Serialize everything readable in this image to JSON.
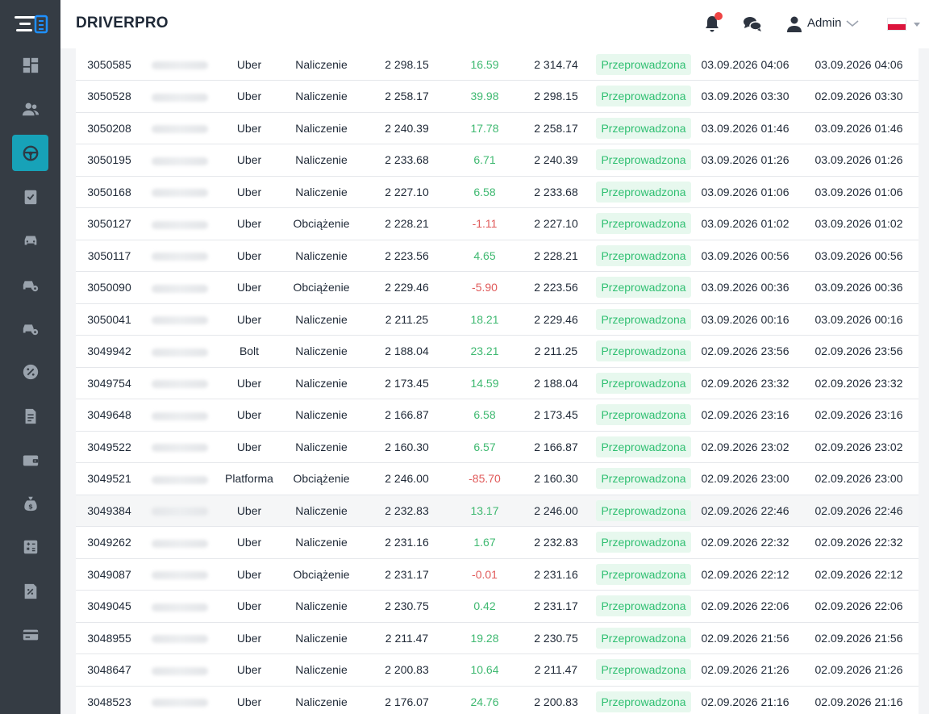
{
  "app": {
    "brand": "DRIVERPRO"
  },
  "header": {
    "user_name": "Admin"
  },
  "sidebar": {
    "items": [
      {
        "icon": "dashboard-icon"
      },
      {
        "icon": "users-icon"
      },
      {
        "icon": "steering-wheel-icon",
        "active": true
      },
      {
        "icon": "clipboard-check-icon"
      },
      {
        "icon": "car-icon"
      },
      {
        "icon": "car-settings-icon"
      },
      {
        "icon": "car-settings-icon"
      },
      {
        "icon": "percent-badge-icon"
      },
      {
        "icon": "invoice-icon"
      },
      {
        "icon": "wallet-icon"
      },
      {
        "icon": "money-bag-icon"
      },
      {
        "icon": "calculator-icon"
      },
      {
        "icon": "tax-receipt-icon"
      },
      {
        "icon": "credit-card-icon"
      }
    ]
  },
  "colors": {
    "sidebar": "#353c44",
    "active": "#17a2b8",
    "positive": "#3fb971",
    "negative": "#e05a5a",
    "badge_bg": "#e7f8ee"
  },
  "table": {
    "rows": [
      {
        "id": "3050585",
        "platform": "Uber",
        "type": "Naliczenie",
        "before": "2 298.15",
        "amount": "16.59",
        "sign": "pos",
        "after": "2 314.74",
        "status": "Przeprowadzona",
        "date1": "03.09.2026 04:06",
        "date2": "03.09.2026 04:06"
      },
      {
        "id": "3050528",
        "platform": "Uber",
        "type": "Naliczenie",
        "before": "2 258.17",
        "amount": "39.98",
        "sign": "pos",
        "after": "2 298.15",
        "status": "Przeprowadzona",
        "date1": "03.09.2026 03:30",
        "date2": "02.09.2026 03:30"
      },
      {
        "id": "3050208",
        "platform": "Uber",
        "type": "Naliczenie",
        "before": "2 240.39",
        "amount": "17.78",
        "sign": "pos",
        "after": "2 258.17",
        "status": "Przeprowadzona",
        "date1": "03.09.2026 01:46",
        "date2": "03.09.2026 01:46"
      },
      {
        "id": "3050195",
        "platform": "Uber",
        "type": "Naliczenie",
        "before": "2 233.68",
        "amount": "6.71",
        "sign": "pos",
        "after": "2 240.39",
        "status": "Przeprowadzona",
        "date1": "03.09.2026 01:26",
        "date2": "03.09.2026 01:26"
      },
      {
        "id": "3050168",
        "platform": "Uber",
        "type": "Naliczenie",
        "before": "2 227.10",
        "amount": "6.58",
        "sign": "pos",
        "after": "2 233.68",
        "status": "Przeprowadzona",
        "date1": "03.09.2026 01:06",
        "date2": "03.09.2026 01:06"
      },
      {
        "id": "3050127",
        "platform": "Uber",
        "type": "Obciążenie",
        "before": "2 228.21",
        "amount": "-1.11",
        "sign": "neg",
        "after": "2 227.10",
        "status": "Przeprowadzona",
        "date1": "03.09.2026 01:02",
        "date2": "03.09.2026 01:02"
      },
      {
        "id": "3050117",
        "platform": "Uber",
        "type": "Naliczenie",
        "before": "2 223.56",
        "amount": "4.65",
        "sign": "pos",
        "after": "2 228.21",
        "status": "Przeprowadzona",
        "date1": "03.09.2026 00:56",
        "date2": "03.09.2026 00:56"
      },
      {
        "id": "3050090",
        "platform": "Uber",
        "type": "Obciążenie",
        "before": "2 229.46",
        "amount": "-5.90",
        "sign": "neg",
        "after": "2 223.56",
        "status": "Przeprowadzona",
        "date1": "03.09.2026 00:36",
        "date2": "03.09.2026 00:36"
      },
      {
        "id": "3050041",
        "platform": "Uber",
        "type": "Naliczenie",
        "before": "2 211.25",
        "amount": "18.21",
        "sign": "pos",
        "after": "2 229.46",
        "status": "Przeprowadzona",
        "date1": "03.09.2026 00:16",
        "date2": "03.09.2026 00:16"
      },
      {
        "id": "3049942",
        "platform": "Bolt",
        "type": "Naliczenie",
        "before": "2 188.04",
        "amount": "23.21",
        "sign": "pos",
        "after": "2 211.25",
        "status": "Przeprowadzona",
        "date1": "02.09.2026 23:56",
        "date2": "02.09.2026 23:56"
      },
      {
        "id": "3049754",
        "platform": "Uber",
        "type": "Naliczenie",
        "before": "2 173.45",
        "amount": "14.59",
        "sign": "pos",
        "after": "2 188.04",
        "status": "Przeprowadzona",
        "date1": "02.09.2026 23:32",
        "date2": "02.09.2026 23:32"
      },
      {
        "id": "3049648",
        "platform": "Uber",
        "type": "Naliczenie",
        "before": "2 166.87",
        "amount": "6.58",
        "sign": "pos",
        "after": "2 173.45",
        "status": "Przeprowadzona",
        "date1": "02.09.2026 23:16",
        "date2": "02.09.2026 23:16"
      },
      {
        "id": "3049522",
        "platform": "Uber",
        "type": "Naliczenie",
        "before": "2 160.30",
        "amount": "6.57",
        "sign": "pos",
        "after": "2 166.87",
        "status": "Przeprowadzona",
        "date1": "02.09.2026 23:02",
        "date2": "02.09.2026 23:02"
      },
      {
        "id": "3049521",
        "platform": "Platforma",
        "type": "Obciążenie",
        "before": "2 246.00",
        "amount": "-85.70",
        "sign": "neg",
        "after": "2 160.30",
        "status": "Przeprowadzona",
        "date1": "02.09.2026 23:00",
        "date2": "02.09.2026 23:00"
      },
      {
        "id": "3049384",
        "platform": "Uber",
        "type": "Naliczenie",
        "before": "2 232.83",
        "amount": "13.17",
        "sign": "pos",
        "after": "2 246.00",
        "status": "Przeprowadzona",
        "date1": "02.09.2026 22:46",
        "date2": "02.09.2026 22:46",
        "highlight": true
      },
      {
        "id": "3049262",
        "platform": "Uber",
        "type": "Naliczenie",
        "before": "2 231.16",
        "amount": "1.67",
        "sign": "pos",
        "after": "2 232.83",
        "status": "Przeprowadzona",
        "date1": "02.09.2026 22:32",
        "date2": "02.09.2026 22:32"
      },
      {
        "id": "3049087",
        "platform": "Uber",
        "type": "Obciążenie",
        "before": "2 231.17",
        "amount": "-0.01",
        "sign": "neg",
        "after": "2 231.16",
        "status": "Przeprowadzona",
        "date1": "02.09.2026 22:12",
        "date2": "02.09.2026 22:12"
      },
      {
        "id": "3049045",
        "platform": "Uber",
        "type": "Naliczenie",
        "before": "2 230.75",
        "amount": "0.42",
        "sign": "pos",
        "after": "2 231.17",
        "status": "Przeprowadzona",
        "date1": "02.09.2026 22:06",
        "date2": "02.09.2026 22:06"
      },
      {
        "id": "3048955",
        "platform": "Uber",
        "type": "Naliczenie",
        "before": "2 211.47",
        "amount": "19.28",
        "sign": "pos",
        "after": "2 230.75",
        "status": "Przeprowadzona",
        "date1": "02.09.2026 21:56",
        "date2": "02.09.2026 21:56"
      },
      {
        "id": "3048647",
        "platform": "Uber",
        "type": "Naliczenie",
        "before": "2 200.83",
        "amount": "10.64",
        "sign": "pos",
        "after": "2 211.47",
        "status": "Przeprowadzona",
        "date1": "02.09.2026 21:26",
        "date2": "02.09.2026 21:26"
      },
      {
        "id": "3048523",
        "platform": "Uber",
        "type": "Naliczenie",
        "before": "2 176.07",
        "amount": "24.76",
        "sign": "pos",
        "after": "2 200.83",
        "status": "Przeprowadzona",
        "date1": "02.09.2026 21:16",
        "date2": "02.09.2026 21:16"
      }
    ]
  }
}
